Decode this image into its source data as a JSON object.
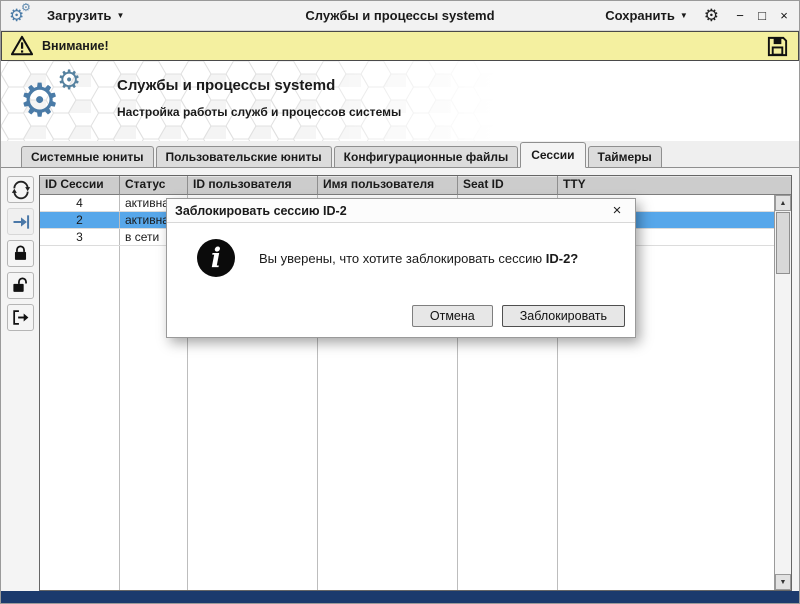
{
  "titlebar": {
    "load_label": "Загрузить",
    "title": "Службы и процессы systemd",
    "save_label": "Сохранить",
    "minimize_glyph": "−",
    "maximize_glyph": "□",
    "close_glyph": "×"
  },
  "glyphs": {
    "caret_down": "▼",
    "gear": "⚙",
    "scroll_up": "▲",
    "scroll_down": "▼",
    "info": "i"
  },
  "warning_bar": {
    "text": "Внимание!"
  },
  "header": {
    "title": "Службы и процессы systemd",
    "subtitle": "Настройка работы служб и процессов системы"
  },
  "tabs": [
    "Системные юниты",
    "Пользовательские юниты",
    "Конфигурационные файлы",
    "Сессии",
    "Таймеры"
  ],
  "active_tab_index": 3,
  "table": {
    "columns": [
      "ID Сессии",
      "Статус",
      "ID пользователя",
      "Имя пользователя",
      "Seat ID",
      "TTY"
    ],
    "rows": [
      {
        "session_id": "4",
        "status": "активна"
      },
      {
        "session_id": "2",
        "status": "активна"
      },
      {
        "session_id": "3",
        "status": "в сети"
      }
    ],
    "selected_row_index": 1
  },
  "dialog": {
    "title": "Заблокировать сессию ID-2",
    "close_glyph": "×",
    "message_prefix": "Вы уверены, что хотите заблокировать сессию ",
    "message_target": "ID-2?",
    "cancel_label": "Отмена",
    "confirm_label": "Заблокировать"
  },
  "colors": {
    "accent_blue": "#4a7ba7",
    "warning_bg": "#f4f0a0",
    "selection_blue": "#57a7ea",
    "footer_navy": "#1b3a6d"
  }
}
